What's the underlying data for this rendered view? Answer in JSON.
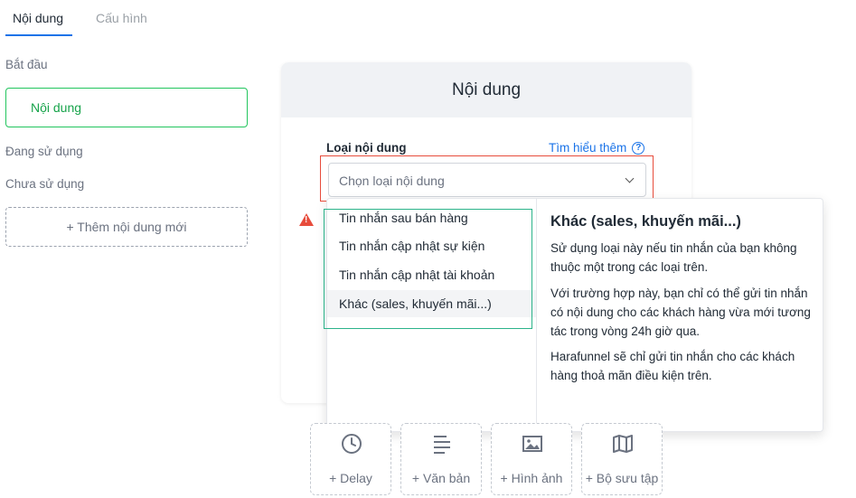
{
  "tabs": [
    {
      "label": "Nội dung",
      "active": true
    },
    {
      "label": "Cấu hình",
      "active": false
    }
  ],
  "sidebar": {
    "start_label": "Bắt đầu",
    "start_item": "Nội dung",
    "in_use_label": "Đang sử dụng",
    "unused_label": "Chưa sử dụng",
    "add_button": "+ Thêm nội dung mới"
  },
  "panel": {
    "title": "Nội dung",
    "field_label": "Loại nội dung",
    "learn_more": "Tìm hiểu thêm",
    "select_placeholder": "Chọn loại nội dung"
  },
  "dropdown": {
    "options": [
      "Tin nhắn sau bán hàng",
      "Tin nhắn cập nhật sự kiện",
      "Tin nhắn cập nhật tài khoản",
      "Khác (sales, khuyến mãi...)"
    ],
    "highlighted_index": 3,
    "description": {
      "title": "Khác (sales, khuyến mãi...)",
      "paragraphs": [
        "Sử dụng loại này nếu tin nhắn của bạn không thuộc một trong các loại trên.",
        "Với trường hợp này, bạn chỉ có thể gửi tin nhắn có nội dung cho các khách hàng vừa mới tương tác trong vòng 24h giờ qua.",
        "Harafunnel sẽ chỉ gửi tin nhắn cho các khách hàng thoả mãn điều kiện trên."
      ]
    }
  },
  "toolbar": [
    {
      "label": "+ Delay",
      "icon": "clock-icon"
    },
    {
      "label": "+ Văn bản",
      "icon": "text-lines-icon"
    },
    {
      "label": "+ Hình ảnh",
      "icon": "image-icon"
    },
    {
      "label": "+ Bộ sưu tập",
      "icon": "map-gallery-icon"
    }
  ],
  "colors": {
    "accent": "#1a73e8",
    "success": "#22c55e",
    "danger": "#e74c3c",
    "teal_highlight": "#2bb38a"
  }
}
